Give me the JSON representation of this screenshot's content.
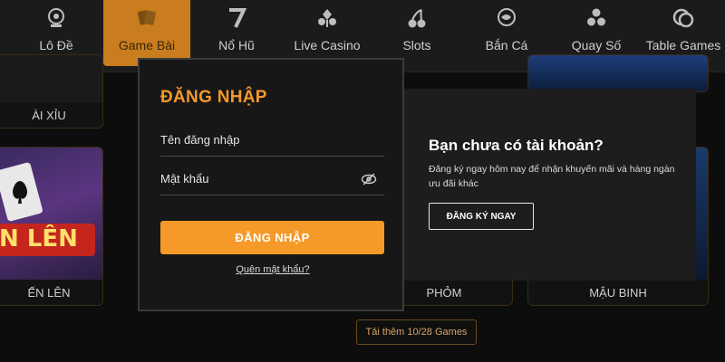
{
  "nav": {
    "items": [
      {
        "label": "Lô Đề",
        "icon": "lottery-ball-icon"
      },
      {
        "label": "Game Bài",
        "icon": "playing-cards-icon",
        "active": true
      },
      {
        "label": "Nổ Hũ",
        "icon": "slot-seven-icon"
      },
      {
        "label": "Live Casino",
        "icon": "card-suits-icon"
      },
      {
        "label": "Slots",
        "icon": "cherry-icon"
      },
      {
        "label": "Bắn Cá",
        "icon": "fish-icon"
      },
      {
        "label": "Quay Số",
        "icon": "lottery-balls-icon"
      },
      {
        "label": "Table Games",
        "icon": "chips-icon"
      }
    ]
  },
  "cards": {
    "c1": "ÀI XỈU",
    "c2": "ẾN LÊN",
    "c2_art": "N LÊN",
    "c3": "PHỎM",
    "c4": "MẬU BINH"
  },
  "more_button": "Tải thêm 10/28 Games",
  "login": {
    "title": "ĐĂNG NHẬP",
    "username_placeholder": "Tên đăng nhập",
    "password_placeholder": "Mật khẩu",
    "submit": "ĐĂNG NHẬP",
    "forgot": "Quên mật khẩu?"
  },
  "register": {
    "title": "Bạn chưa có tài khoản?",
    "description": "Đăng ký ngay hôm nay để nhận khuyến mãi và hàng ngàn ưu đãi khác",
    "button": "ĐĂNG KÝ NGAY"
  },
  "colors": {
    "accent": "#f59a29",
    "nav_active": "#c97d1e",
    "background": "#0d0d0d"
  }
}
